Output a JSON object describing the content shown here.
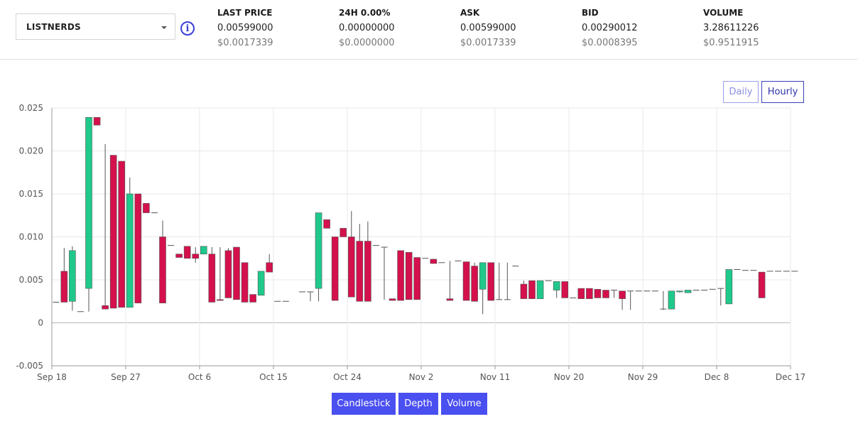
{
  "market": {
    "symbol": "LISTNERDS"
  },
  "info_icon": {
    "glyph": "i",
    "icon": "info-icon"
  },
  "stats": [
    {
      "label": "LAST PRICE",
      "value": "0.00599000",
      "usd": "$0.0017339"
    },
    {
      "label": "24H 0.00%",
      "value": "0.00000000",
      "usd": "$0.0000000"
    },
    {
      "label": "ASK",
      "value": "0.00599000",
      "usd": "$0.0017339"
    },
    {
      "label": "BID",
      "value": "0.00290012",
      "usd": "$0.0008395"
    },
    {
      "label": "VOLUME",
      "value": "3.28611226",
      "usd": "$0.9511915"
    }
  ],
  "interval": {
    "daily": "Daily",
    "hourly": "Hourly",
    "selected": "Hourly"
  },
  "tabs": {
    "candlestick": "Candlestick",
    "depth": "Depth",
    "volume": "Volume"
  },
  "colors": {
    "up": "#1fc98b",
    "down": "#d4114c",
    "accent": "#4a4ff0"
  },
  "chart_data": {
    "type": "candlestick",
    "title": "",
    "ylim": [
      -0.005,
      0.025
    ],
    "yticks": [
      -0.005,
      0,
      0.005,
      0.01,
      0.015,
      0.02,
      0.025
    ],
    "ytick_labels": [
      "-0.005",
      "0",
      "0.005",
      "0.010",
      "0.015",
      "0.020",
      "0.025"
    ],
    "xticks": [
      "Sep 18",
      "Sep 27",
      "Oct 6",
      "Oct 15",
      "Oct 24",
      "Nov 2",
      "Nov 11",
      "Nov 20",
      "Nov 29",
      "Dec 8",
      "Dec 17"
    ],
    "grid": true,
    "start_date": "Sep 18",
    "candles": [
      {
        "d": 0,
        "o": 0.0024,
        "h": 0.0024,
        "l": 0.0024,
        "c": 0.0024
      },
      {
        "d": 1,
        "o": 0.006,
        "h": 0.0087,
        "l": 0.0024,
        "c": 0.0024
      },
      {
        "d": 2,
        "o": 0.0025,
        "h": 0.0089,
        "l": 0.0014,
        "c": 0.0084
      },
      {
        "d": 3,
        "o": 0.0013,
        "h": 0.0013,
        "l": 0.0013,
        "c": 0.0013
      },
      {
        "d": 4,
        "o": 0.004,
        "h": 0.0239,
        "l": 0.0013,
        "c": 0.0239
      },
      {
        "d": 5,
        "o": 0.0239,
        "h": 0.0239,
        "l": 0.023,
        "c": 0.023
      },
      {
        "d": 6,
        "o": 0.002,
        "h": 0.0208,
        "l": 0.0016,
        "c": 0.0016
      },
      {
        "d": 7,
        "o": 0.0195,
        "h": 0.0195,
        "l": 0.0017,
        "c": 0.0017
      },
      {
        "d": 8,
        "o": 0.0188,
        "h": 0.0188,
        "l": 0.0018,
        "c": 0.0018
      },
      {
        "d": 9,
        "o": 0.0018,
        "h": 0.0169,
        "l": 0.0018,
        "c": 0.015
      },
      {
        "d": 10,
        "o": 0.015,
        "h": 0.015,
        "l": 0.0023,
        "c": 0.0023
      },
      {
        "d": 11,
        "o": 0.0139,
        "h": 0.0139,
        "l": 0.0128,
        "c": 0.0128
      },
      {
        "d": 12,
        "o": 0.0128,
        "h": 0.0128,
        "l": 0.0128,
        "c": 0.0128
      },
      {
        "d": 13,
        "o": 0.01,
        "h": 0.0119,
        "l": 0.0023,
        "c": 0.0023
      },
      {
        "d": 14,
        "o": 0.009,
        "h": 0.009,
        "l": 0.009,
        "c": 0.009
      },
      {
        "d": 15,
        "o": 0.008,
        "h": 0.008,
        "l": 0.0076,
        "c": 0.0076
      },
      {
        "d": 16,
        "o": 0.0089,
        "h": 0.0089,
        "l": 0.0075,
        "c": 0.0075
      },
      {
        "d": 17,
        "o": 0.008,
        "h": 0.0088,
        "l": 0.007,
        "c": 0.0075
      },
      {
        "d": 18,
        "o": 0.008,
        "h": 0.0089,
        "l": 0.008,
        "c": 0.0089
      },
      {
        "d": 19,
        "o": 0.008,
        "h": 0.0088,
        "l": 0.0024,
        "c": 0.0024
      },
      {
        "d": 20,
        "o": 0.0027,
        "h": 0.0088,
        "l": 0.0026,
        "c": 0.0026
      },
      {
        "d": 21,
        "o": 0.0084,
        "h": 0.0087,
        "l": 0.0029,
        "c": 0.0029
      },
      {
        "d": 22,
        "o": 0.0088,
        "h": 0.0088,
        "l": 0.0027,
        "c": 0.0027
      },
      {
        "d": 23,
        "o": 0.007,
        "h": 0.007,
        "l": 0.0024,
        "c": 0.0024
      },
      {
        "d": 24,
        "o": 0.0033,
        "h": 0.0033,
        "l": 0.0024,
        "c": 0.0024
      },
      {
        "d": 25,
        "o": 0.0032,
        "h": 0.006,
        "l": 0.0032,
        "c": 0.006
      },
      {
        "d": 26,
        "o": 0.007,
        "h": 0.008,
        "l": 0.0059,
        "c": 0.0059
      },
      {
        "d": 27,
        "o": 0.0025,
        "h": 0.0025,
        "l": 0.0025,
        "c": 0.0025
      },
      {
        "d": 28,
        "o": 0.0025,
        "h": 0.0025,
        "l": 0.0025,
        "c": 0.0025
      },
      {
        "d": 30,
        "o": 0.0036,
        "h": 0.0036,
        "l": 0.0036,
        "c": 0.0036
      },
      {
        "d": 31,
        "o": 0.0036,
        "h": 0.0036,
        "l": 0.0025,
        "c": 0.0036
      },
      {
        "d": 32,
        "o": 0.004,
        "h": 0.0128,
        "l": 0.0025,
        "c": 0.0128
      },
      {
        "d": 33,
        "o": 0.012,
        "h": 0.012,
        "l": 0.011,
        "c": 0.011
      },
      {
        "d": 34,
        "o": 0.01,
        "h": 0.01,
        "l": 0.0026,
        "c": 0.0026
      },
      {
        "d": 35,
        "o": 0.011,
        "h": 0.011,
        "l": 0.01,
        "c": 0.01
      },
      {
        "d": 36,
        "o": 0.01,
        "h": 0.013,
        "l": 0.003,
        "c": 0.003
      },
      {
        "d": 37,
        "o": 0.0095,
        "h": 0.0115,
        "l": 0.0025,
        "c": 0.0025
      },
      {
        "d": 38,
        "o": 0.0095,
        "h": 0.0118,
        "l": 0.0025,
        "c": 0.0025
      },
      {
        "d": 39,
        "o": 0.009,
        "h": 0.009,
        "l": 0.009,
        "c": 0.009
      },
      {
        "d": 40,
        "o": 0.0088,
        "h": 0.0088,
        "l": 0.0027,
        "c": 0.0088
      },
      {
        "d": 41,
        "o": 0.0028,
        "h": 0.0028,
        "l": 0.0026,
        "c": 0.0026
      },
      {
        "d": 42,
        "o": 0.0084,
        "h": 0.0084,
        "l": 0.0026,
        "c": 0.0026
      },
      {
        "d": 43,
        "o": 0.0082,
        "h": 0.0082,
        "l": 0.0027,
        "c": 0.0027
      },
      {
        "d": 44,
        "o": 0.0076,
        "h": 0.0076,
        "l": 0.0027,
        "c": 0.0027
      },
      {
        "d": 45,
        "o": 0.0075,
        "h": 0.0075,
        "l": 0.0075,
        "c": 0.0075
      },
      {
        "d": 46,
        "o": 0.0074,
        "h": 0.0074,
        "l": 0.0069,
        "c": 0.0069
      },
      {
        "d": 47,
        "o": 0.007,
        "h": 0.007,
        "l": 0.007,
        "c": 0.007
      },
      {
        "d": 48,
        "o": 0.0028,
        "h": 0.0072,
        "l": 0.0026,
        "c": 0.0026
      },
      {
        "d": 49,
        "o": 0.0072,
        "h": 0.0072,
        "l": 0.0072,
        "c": 0.0072
      },
      {
        "d": 50,
        "o": 0.0071,
        "h": 0.0071,
        "l": 0.0026,
        "c": 0.0026
      },
      {
        "d": 51,
        "o": 0.0066,
        "h": 0.007,
        "l": 0.0025,
        "c": 0.0025
      },
      {
        "d": 52,
        "o": 0.0039,
        "h": 0.007,
        "l": 0.001,
        "c": 0.007
      },
      {
        "d": 53,
        "o": 0.007,
        "h": 0.007,
        "l": 0.0026,
        "c": 0.0026
      },
      {
        "d": 54,
        "o": 0.0027,
        "h": 0.007,
        "l": 0.0027,
        "c": 0.0027
      },
      {
        "d": 55,
        "o": 0.0027,
        "h": 0.007,
        "l": 0.0027,
        "c": 0.0027
      },
      {
        "d": 56,
        "o": 0.0066,
        "h": 0.0066,
        "l": 0.0066,
        "c": 0.0066
      },
      {
        "d": 57,
        "o": 0.0045,
        "h": 0.0049,
        "l": 0.0028,
        "c": 0.0028
      },
      {
        "d": 58,
        "o": 0.0049,
        "h": 0.0049,
        "l": 0.0028,
        "c": 0.0028
      },
      {
        "d": 59,
        "o": 0.0028,
        "h": 0.0049,
        "l": 0.0028,
        "c": 0.0049
      },
      {
        "d": 60,
        "o": 0.0049,
        "h": 0.0049,
        "l": 0.0049,
        "c": 0.0049
      },
      {
        "d": 61,
        "o": 0.0038,
        "h": 0.0046,
        "l": 0.0029,
        "c": 0.0048
      },
      {
        "d": 62,
        "o": 0.0048,
        "h": 0.0048,
        "l": 0.0029,
        "c": 0.0029
      },
      {
        "d": 63,
        "o": 0.0029,
        "h": 0.0029,
        "l": 0.0029,
        "c": 0.0029
      },
      {
        "d": 64,
        "o": 0.004,
        "h": 0.004,
        "l": 0.0028,
        "c": 0.0028
      },
      {
        "d": 65,
        "o": 0.004,
        "h": 0.004,
        "l": 0.0028,
        "c": 0.0028
      },
      {
        "d": 66,
        "o": 0.0039,
        "h": 0.0039,
        "l": 0.0029,
        "c": 0.0029
      },
      {
        "d": 67,
        "o": 0.0038,
        "h": 0.0038,
        "l": 0.0029,
        "c": 0.0029
      },
      {
        "d": 68,
        "o": 0.0038,
        "h": 0.0038,
        "l": 0.0029,
        "c": 0.0038
      },
      {
        "d": 69,
        "o": 0.0037,
        "h": 0.0037,
        "l": 0.0015,
        "c": 0.0028
      },
      {
        "d": 70,
        "o": 0.0037,
        "h": 0.0037,
        "l": 0.0015,
        "c": 0.0037
      },
      {
        "d": 71,
        "o": 0.0037,
        "h": 0.0037,
        "l": 0.0037,
        "c": 0.0037
      },
      {
        "d": 72,
        "o": 0.0037,
        "h": 0.0037,
        "l": 0.0037,
        "c": 0.0037
      },
      {
        "d": 73,
        "o": 0.0037,
        "h": 0.0037,
        "l": 0.0037,
        "c": 0.0037
      },
      {
        "d": 74,
        "o": 0.0016,
        "h": 0.0037,
        "l": 0.0015,
        "c": 0.0016
      },
      {
        "d": 75,
        "o": 0.0016,
        "h": 0.0037,
        "l": 0.0016,
        "c": 0.0037
      },
      {
        "d": 76,
        "o": 0.0036,
        "h": 0.0037,
        "l": 0.0035,
        "c": 0.0037
      },
      {
        "d": 77,
        "o": 0.0035,
        "h": 0.0038,
        "l": 0.0035,
        "c": 0.0038
      },
      {
        "d": 78,
        "o": 0.0038,
        "h": 0.0038,
        "l": 0.0038,
        "c": 0.0038
      },
      {
        "d": 79,
        "o": 0.0038,
        "h": 0.0038,
        "l": 0.0038,
        "c": 0.0038
      },
      {
        "d": 80,
        "o": 0.0039,
        "h": 0.0039,
        "l": 0.0039,
        "c": 0.0039
      },
      {
        "d": 81,
        "o": 0.004,
        "h": 0.004,
        "l": 0.002,
        "c": 0.004
      },
      {
        "d": 82,
        "o": 0.0022,
        "h": 0.0062,
        "l": 0.0022,
        "c": 0.0062
      },
      {
        "d": 83,
        "o": 0.0062,
        "h": 0.0062,
        "l": 0.0062,
        "c": 0.0062
      },
      {
        "d": 84,
        "o": 0.0061,
        "h": 0.0061,
        "l": 0.0061,
        "c": 0.0061
      },
      {
        "d": 85,
        "o": 0.0061,
        "h": 0.0061,
        "l": 0.0061,
        "c": 0.0061
      },
      {
        "d": 86,
        "o": 0.0059,
        "h": 0.0059,
        "l": 0.0029,
        "c": 0.0029
      },
      {
        "d": 87,
        "o": 0.006,
        "h": 0.006,
        "l": 0.006,
        "c": 0.006
      },
      {
        "d": 88,
        "o": 0.006,
        "h": 0.006,
        "l": 0.006,
        "c": 0.006
      },
      {
        "d": 89,
        "o": 0.006,
        "h": 0.006,
        "l": 0.006,
        "c": 0.006
      },
      {
        "d": 90,
        "o": 0.006,
        "h": 0.006,
        "l": 0.006,
        "c": 0.006
      }
    ]
  }
}
